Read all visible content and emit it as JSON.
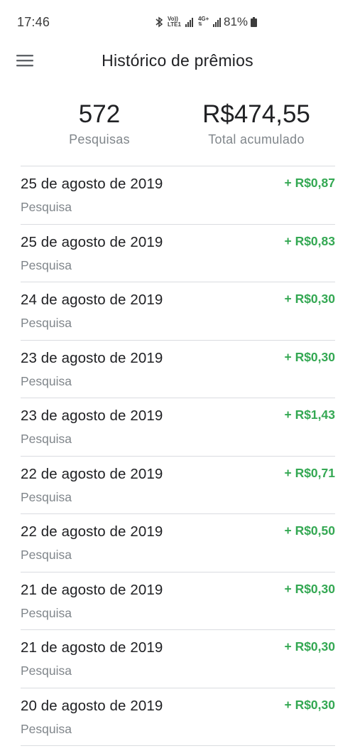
{
  "status_bar": {
    "time": "17:46",
    "network_top": "Vo))",
    "network_bottom": "LTE1",
    "network_4g": "4G+",
    "battery_percent": "81%"
  },
  "header": {
    "menu_icon": "hamburger-menu-icon",
    "title": "Histórico de prêmios"
  },
  "summary": {
    "surveys_count": "572",
    "surveys_label": "Pesquisas",
    "total_value": "R$474,55",
    "total_label": "Total acumulado"
  },
  "history": [
    {
      "date": "25 de agosto de 2019",
      "type": "Pesquisa",
      "amount": "+ R$0,87"
    },
    {
      "date": "25 de agosto de 2019",
      "type": "Pesquisa",
      "amount": "+ R$0,83"
    },
    {
      "date": "24 de agosto de 2019",
      "type": "Pesquisa",
      "amount": "+ R$0,30"
    },
    {
      "date": "23 de agosto de 2019",
      "type": "Pesquisa",
      "amount": "+ R$0,30"
    },
    {
      "date": "23 de agosto de 2019",
      "type": "Pesquisa",
      "amount": "+ R$1,43"
    },
    {
      "date": "22 de agosto de 2019",
      "type": "Pesquisa",
      "amount": "+ R$0,71"
    },
    {
      "date": "22 de agosto de 2019",
      "type": "Pesquisa",
      "amount": "+ R$0,50"
    },
    {
      "date": "21 de agosto de 2019",
      "type": "Pesquisa",
      "amount": "+ R$0,30"
    },
    {
      "date": "21 de agosto de 2019",
      "type": "Pesquisa",
      "amount": "+ R$0,30"
    },
    {
      "date": "20 de agosto de 2019",
      "type": "Pesquisa",
      "amount": "+ R$0,30"
    }
  ],
  "colors": {
    "positive_amount": "#34a853",
    "secondary_text": "#80868b",
    "divider": "#dadce0"
  }
}
